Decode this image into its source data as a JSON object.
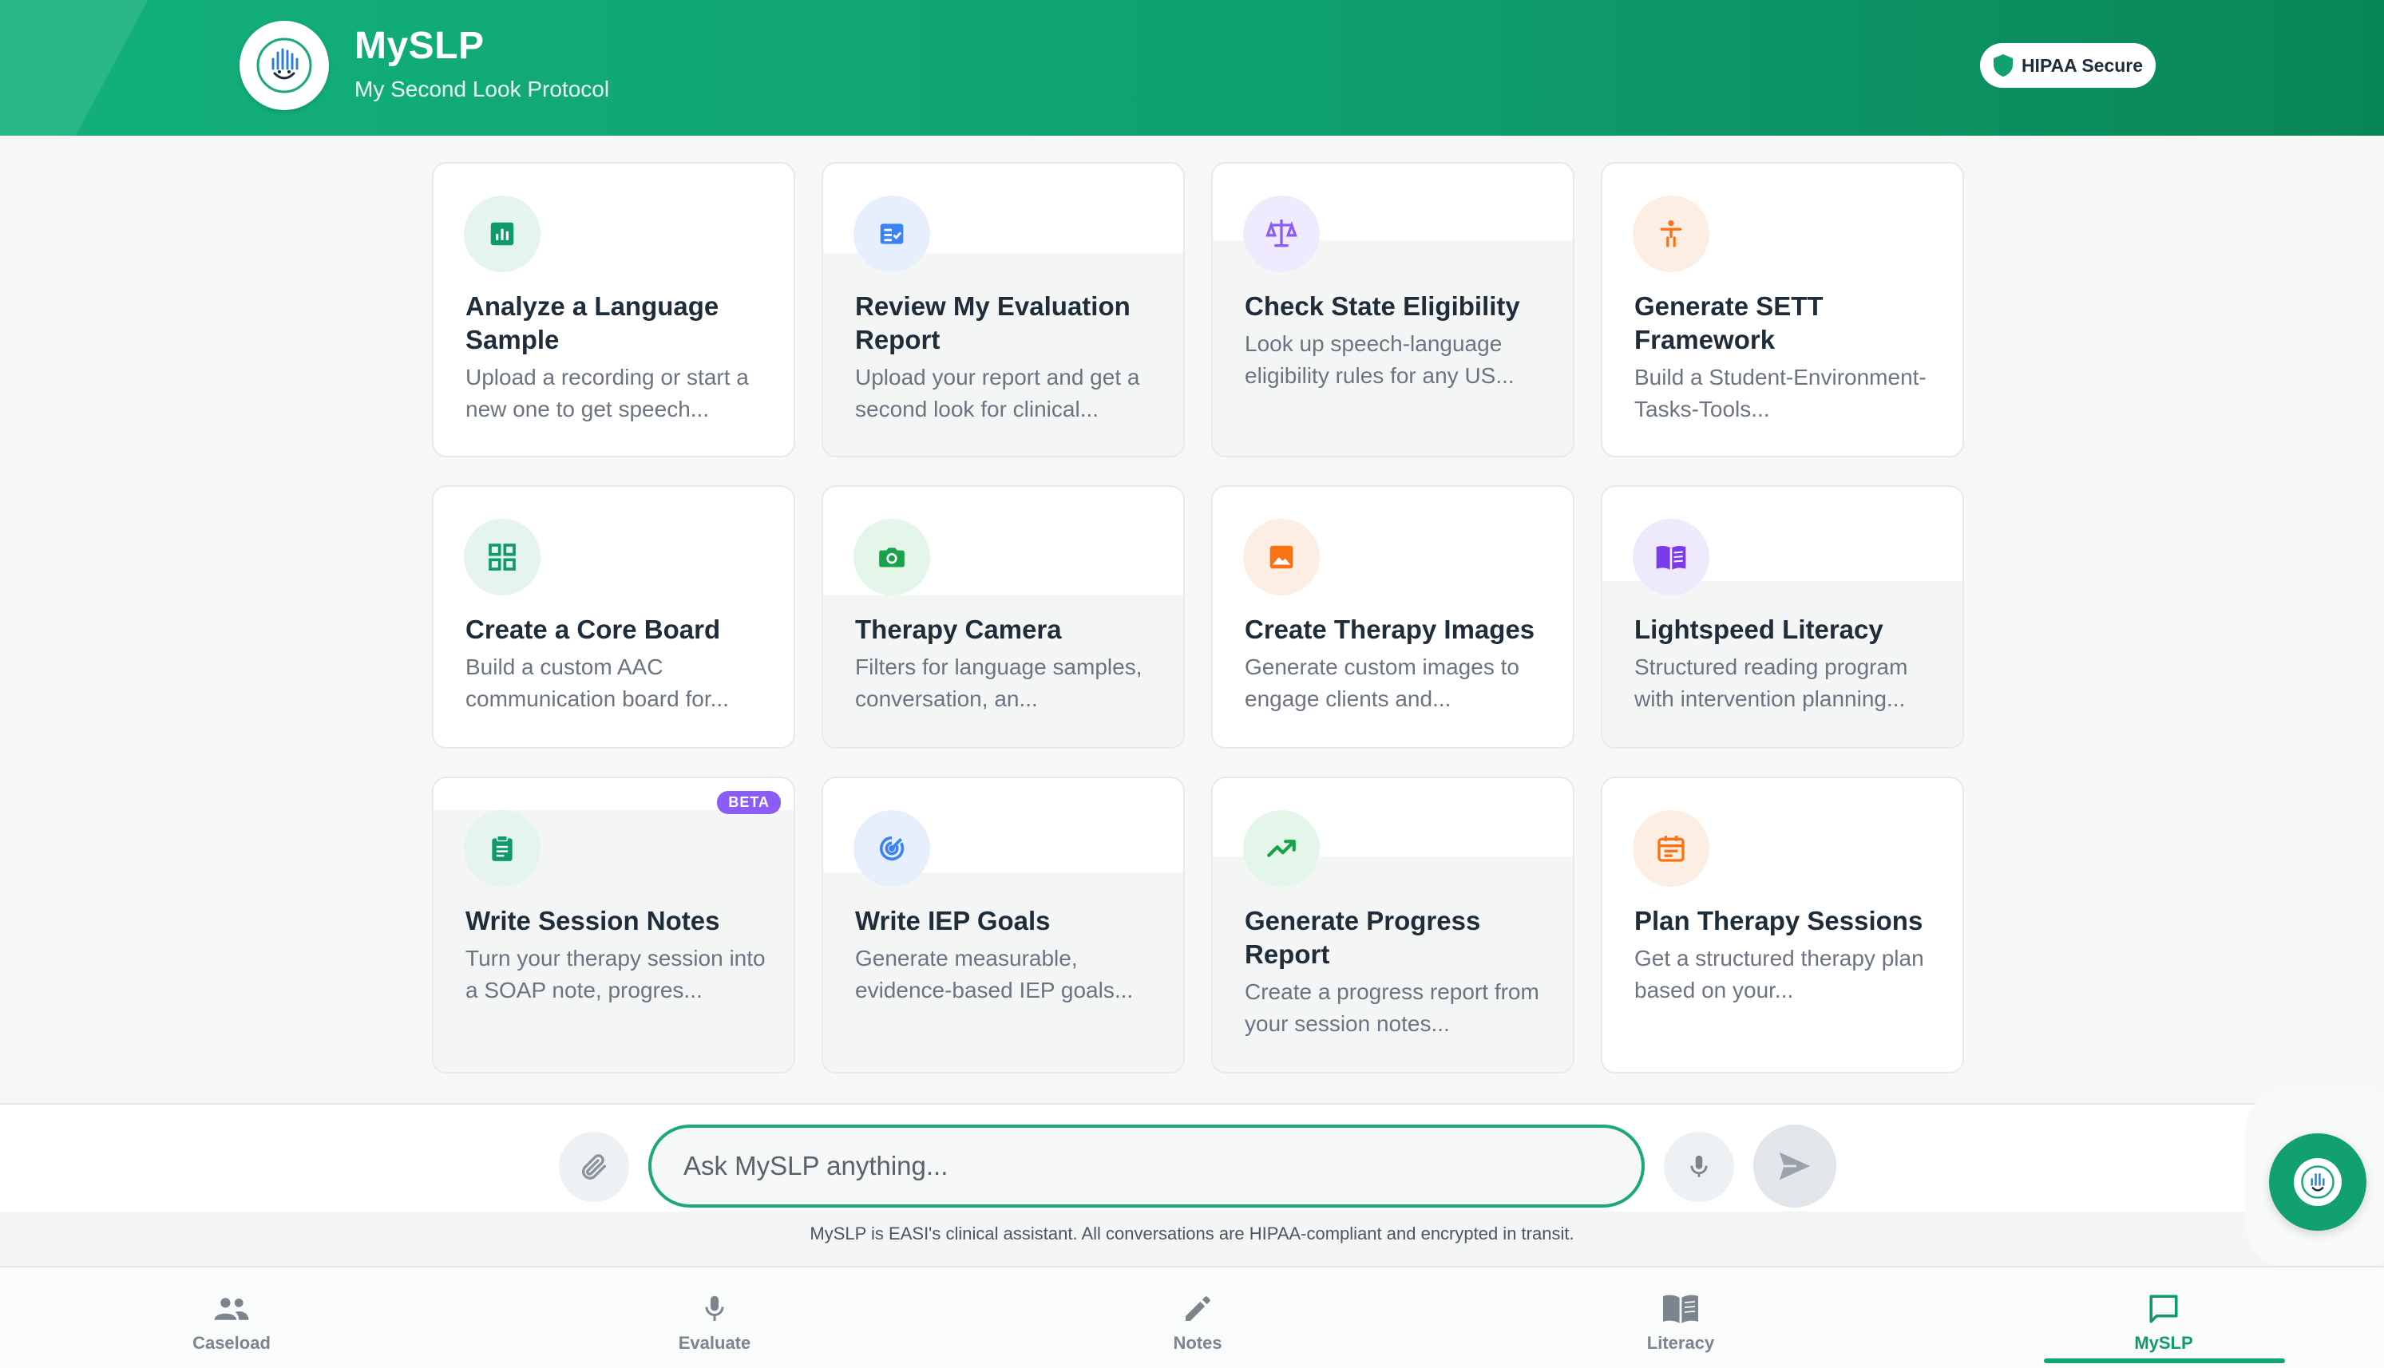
{
  "header": {
    "title": "MySLP",
    "subtitle": "My Second Look Protocol",
    "badge": "HIPAA Secure"
  },
  "cards": [
    {
      "title": "Analyze a Language Sample",
      "description": "Upload a recording or start a new one to get speech...",
      "icon": "bar-chart-icon",
      "color": "#0f9a6a"
    },
    {
      "title": "Review My Evaluation Report",
      "description": "Upload your report and get a second look for clinical...",
      "icon": "checklist-icon",
      "color": "#3b82f6"
    },
    {
      "title": "Check State Eligibility",
      "description": "Look up speech-language eligibility rules for any US...",
      "icon": "scale-icon",
      "color": "#8b5cf6"
    },
    {
      "title": "Generate SETT Framework",
      "description": "Build a Student-Environment-Tasks-Tools...",
      "icon": "accessibility-icon",
      "color": "#f97316"
    },
    {
      "title": "Create a Core Board",
      "description": "Build a custom AAC communication board for...",
      "icon": "grid-icon",
      "color": "#0f9a6a"
    },
    {
      "title": "Therapy Camera",
      "description": "Filters for language samples, conversation, an...",
      "icon": "camera-icon",
      "color": "#16a34a"
    },
    {
      "title": "Create Therapy Images",
      "description": "Generate custom images to engage clients and...",
      "icon": "image-icon",
      "color": "#f97316"
    },
    {
      "title": "Lightspeed Literacy",
      "description": "Structured reading program with intervention planning...",
      "icon": "book-icon",
      "color": "#7c3aed"
    },
    {
      "title": "Write Session Notes",
      "description": "Turn your therapy session into a SOAP note, progres...",
      "icon": "clipboard-icon",
      "color": "#0f9a6a",
      "badge": "BETA"
    },
    {
      "title": "Write IEP Goals",
      "description": "Generate measurable, evidence-based IEP goals...",
      "icon": "target-icon",
      "color": "#3b82f6"
    },
    {
      "title": "Generate Progress Report",
      "description": "Create a progress report from your session notes...",
      "icon": "trending-up-icon",
      "color": "#16a34a"
    },
    {
      "title": "Plan Therapy Sessions",
      "description": "Get a structured therapy plan based on your...",
      "icon": "calendar-icon",
      "color": "#f97316"
    }
  ],
  "chat": {
    "placeholder": "Ask MySLP anything...",
    "disclaimer": "MySLP is EASI's clinical assistant. All conversations are HIPAA-compliant and encrypted in transit."
  },
  "nav": [
    {
      "label": "Caseload",
      "icon": "people-icon"
    },
    {
      "label": "Evaluate",
      "icon": "mic-icon"
    },
    {
      "label": "Notes",
      "icon": "pencil-icon"
    },
    {
      "label": "Literacy",
      "icon": "book-icon"
    },
    {
      "label": "MySLP",
      "icon": "chat-icon",
      "active": true
    }
  ]
}
